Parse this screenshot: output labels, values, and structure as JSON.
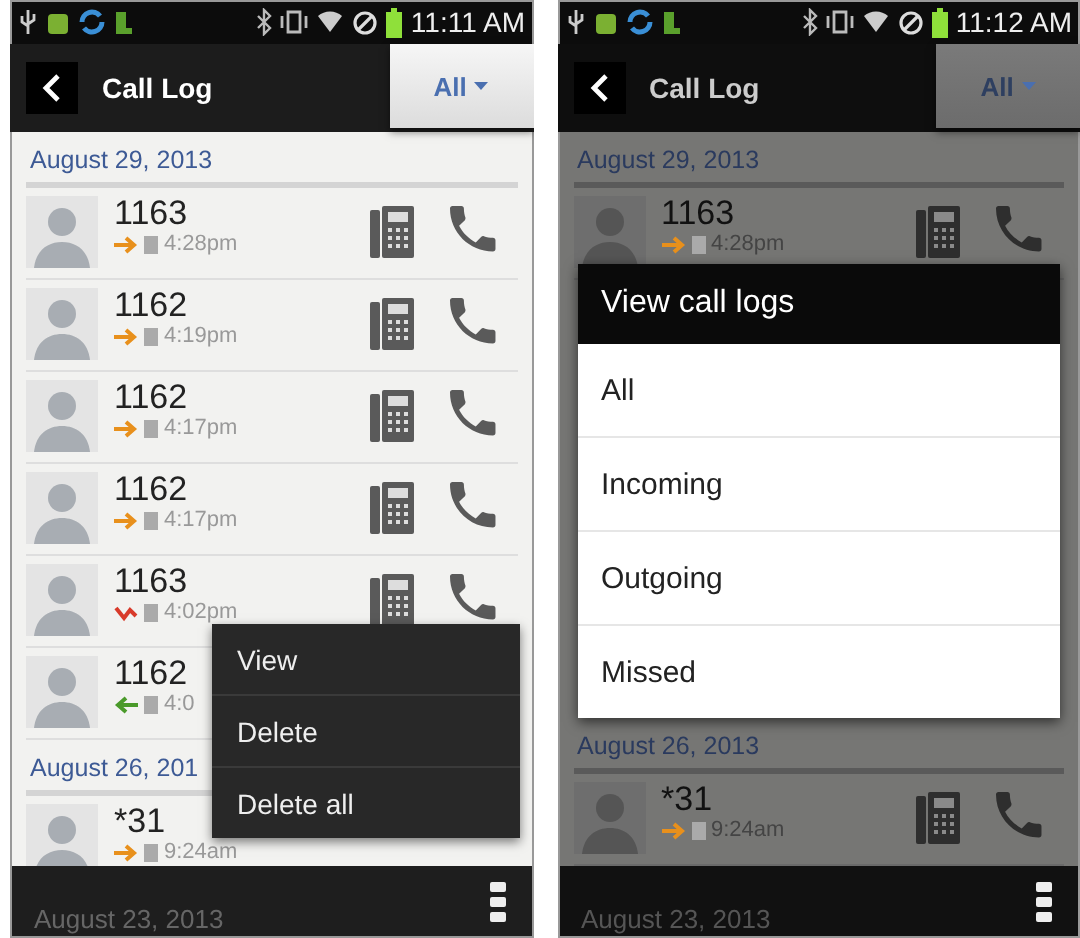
{
  "screens": [
    {
      "dimmed": false,
      "status_time": "11:11 AM",
      "title": "Call Log",
      "filter": "All",
      "sections": [
        {
          "date": "August 29, 2013",
          "calls": [
            {
              "number": "1163",
              "kind": "outgoing",
              "time": "4:28pm",
              "actions": true
            },
            {
              "number": "1162",
              "kind": "outgoing",
              "time": "4:19pm",
              "actions": true
            },
            {
              "number": "1162",
              "kind": "outgoing",
              "time": "4:17pm",
              "actions": true
            },
            {
              "number": "1162",
              "kind": "outgoing",
              "time": "4:17pm",
              "actions": true
            },
            {
              "number": "1163",
              "kind": "missed",
              "time": "4:02pm",
              "actions": true
            },
            {
              "number": "1162",
              "kind": "incoming",
              "time": "4:0",
              "actions": false
            }
          ]
        },
        {
          "date": "August 26, 201",
          "calls": [
            {
              "number": "*31",
              "kind": "outgoing",
              "time": "9:24am",
              "actions": false
            }
          ]
        }
      ],
      "footer_date": "August 23, 2013",
      "popup_menu": {
        "items": [
          "View",
          "Delete",
          "Delete all"
        ]
      }
    },
    {
      "dimmed": true,
      "status_time": "11:12 AM",
      "title": "Call Log",
      "filter": "All",
      "sections": [
        {
          "date": "August 29, 2013",
          "calls": [
            {
              "number": "1163",
              "kind": "outgoing",
              "time": "4:28pm",
              "actions": true
            }
          ]
        },
        {
          "date": "August 26, 2013",
          "calls": [
            {
              "number": "*31",
              "kind": "outgoing",
              "time": "9:24am",
              "actions": true
            }
          ]
        }
      ],
      "footer_date": "August 23, 2013",
      "dialog": {
        "title": "View call logs",
        "options": [
          {
            "label": "All",
            "selected": false
          },
          {
            "label": "Incoming",
            "selected": false
          },
          {
            "label": "Outgoing",
            "selected": false
          },
          {
            "label": "Missed",
            "selected": false
          }
        ]
      }
    }
  ]
}
